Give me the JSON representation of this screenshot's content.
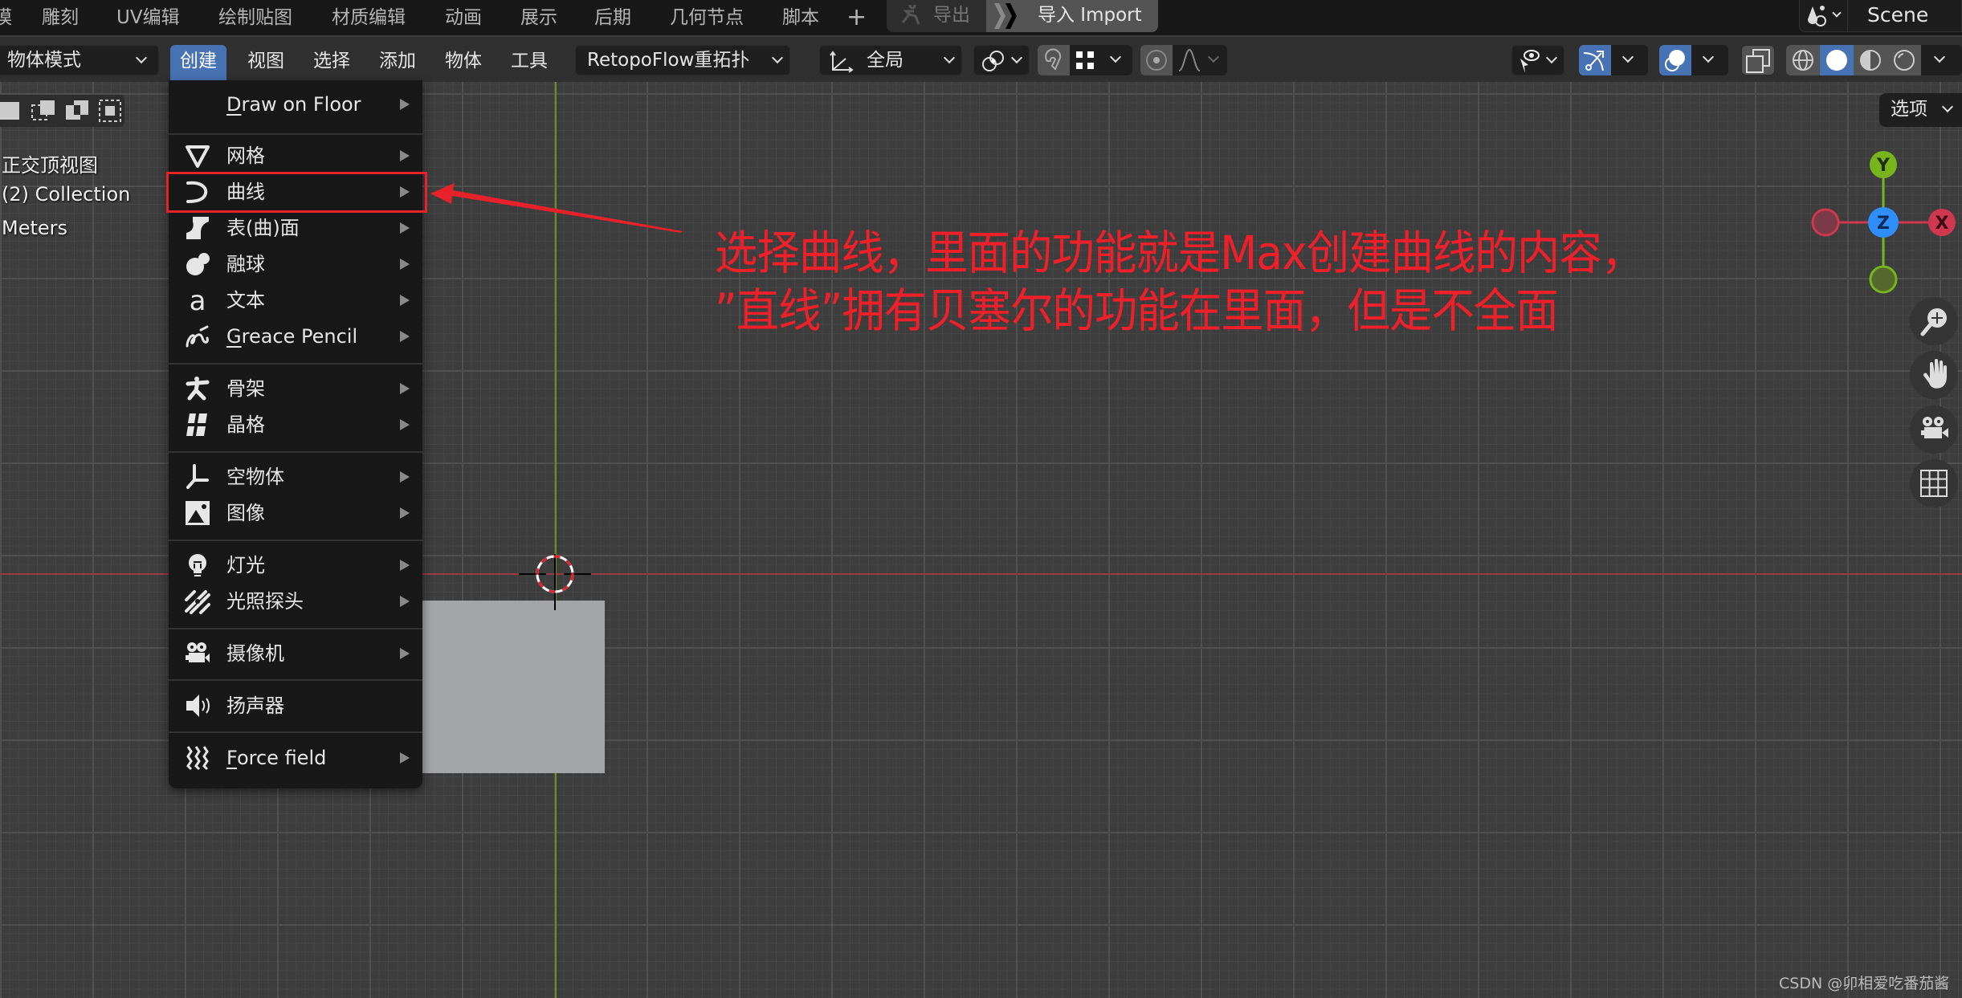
{
  "workspace_tabs": [
    "模",
    "雕刻",
    "UV编辑",
    "绘制贴图",
    "材质编辑",
    "动画",
    "展示",
    "后期",
    "几何节点",
    "脚本"
  ],
  "topbar": {
    "add_workspace": "+",
    "export_label": "导出",
    "import_label": "导入 Import",
    "scene_label": "Scene"
  },
  "header": {
    "mode_select": "物体模式",
    "menus": [
      "创建",
      "视图",
      "选择",
      "添加",
      "物体",
      "工具"
    ],
    "active_menu": "创建",
    "addon_select": "RetopoFlow重拓扑",
    "transform_orientation": "全局",
    "shading_active": "solid"
  },
  "viewport": {
    "view_name": "正交顶视图",
    "collection": "(2) Collection",
    "units": "Meters",
    "options_label": "选项"
  },
  "create_menu": {
    "items": [
      {
        "label": "Draw on Floor",
        "icon": "none",
        "submenu": true,
        "underline": "D"
      },
      {
        "label": "网格",
        "icon": "mesh-icon",
        "submenu": true
      },
      {
        "label": "曲线",
        "icon": "curve-icon",
        "submenu": true,
        "highlighted": true
      },
      {
        "label": "表(曲)面",
        "icon": "surface-icon",
        "submenu": true
      },
      {
        "label": "融球",
        "icon": "metaball-icon",
        "submenu": true
      },
      {
        "label": "文本",
        "icon": "text-icon",
        "submenu": true
      },
      {
        "label": "Greace Pencil",
        "icon": "grease-pencil-icon",
        "submenu": true,
        "underline": "G"
      },
      {
        "label": "骨架",
        "icon": "armature-icon",
        "submenu": true
      },
      {
        "label": "晶格",
        "icon": "lattice-icon",
        "submenu": true
      },
      {
        "label": "空物体",
        "icon": "empty-icon",
        "submenu": true
      },
      {
        "label": "图像",
        "icon": "image-icon",
        "submenu": true
      },
      {
        "label": "灯光",
        "icon": "light-icon",
        "submenu": true
      },
      {
        "label": "光照探头",
        "icon": "light-probe-icon",
        "submenu": true
      },
      {
        "label": "摄像机",
        "icon": "camera-icon",
        "submenu": true
      },
      {
        "label": "扬声器",
        "icon": "speaker-icon",
        "submenu": false
      },
      {
        "label": "Force field",
        "icon": "force-field-icon",
        "submenu": true,
        "underline": "F"
      }
    ]
  },
  "annotation": {
    "line1": "选择曲线，里面的功能就是Max创建曲线的内容，",
    "line2": "”直线”拥有贝塞尔的功能在里面，但是不全面",
    "color": "#f0202a"
  },
  "gizmo": {
    "y_label": "Y",
    "z_label": "Z",
    "x_label": "X",
    "colors": {
      "x": "#d0384f",
      "y": "#78b51d",
      "z": "#2f8ffa"
    }
  },
  "watermark": "CSDN @卯相爱吃番茄酱",
  "accent_color": "#4772b3"
}
